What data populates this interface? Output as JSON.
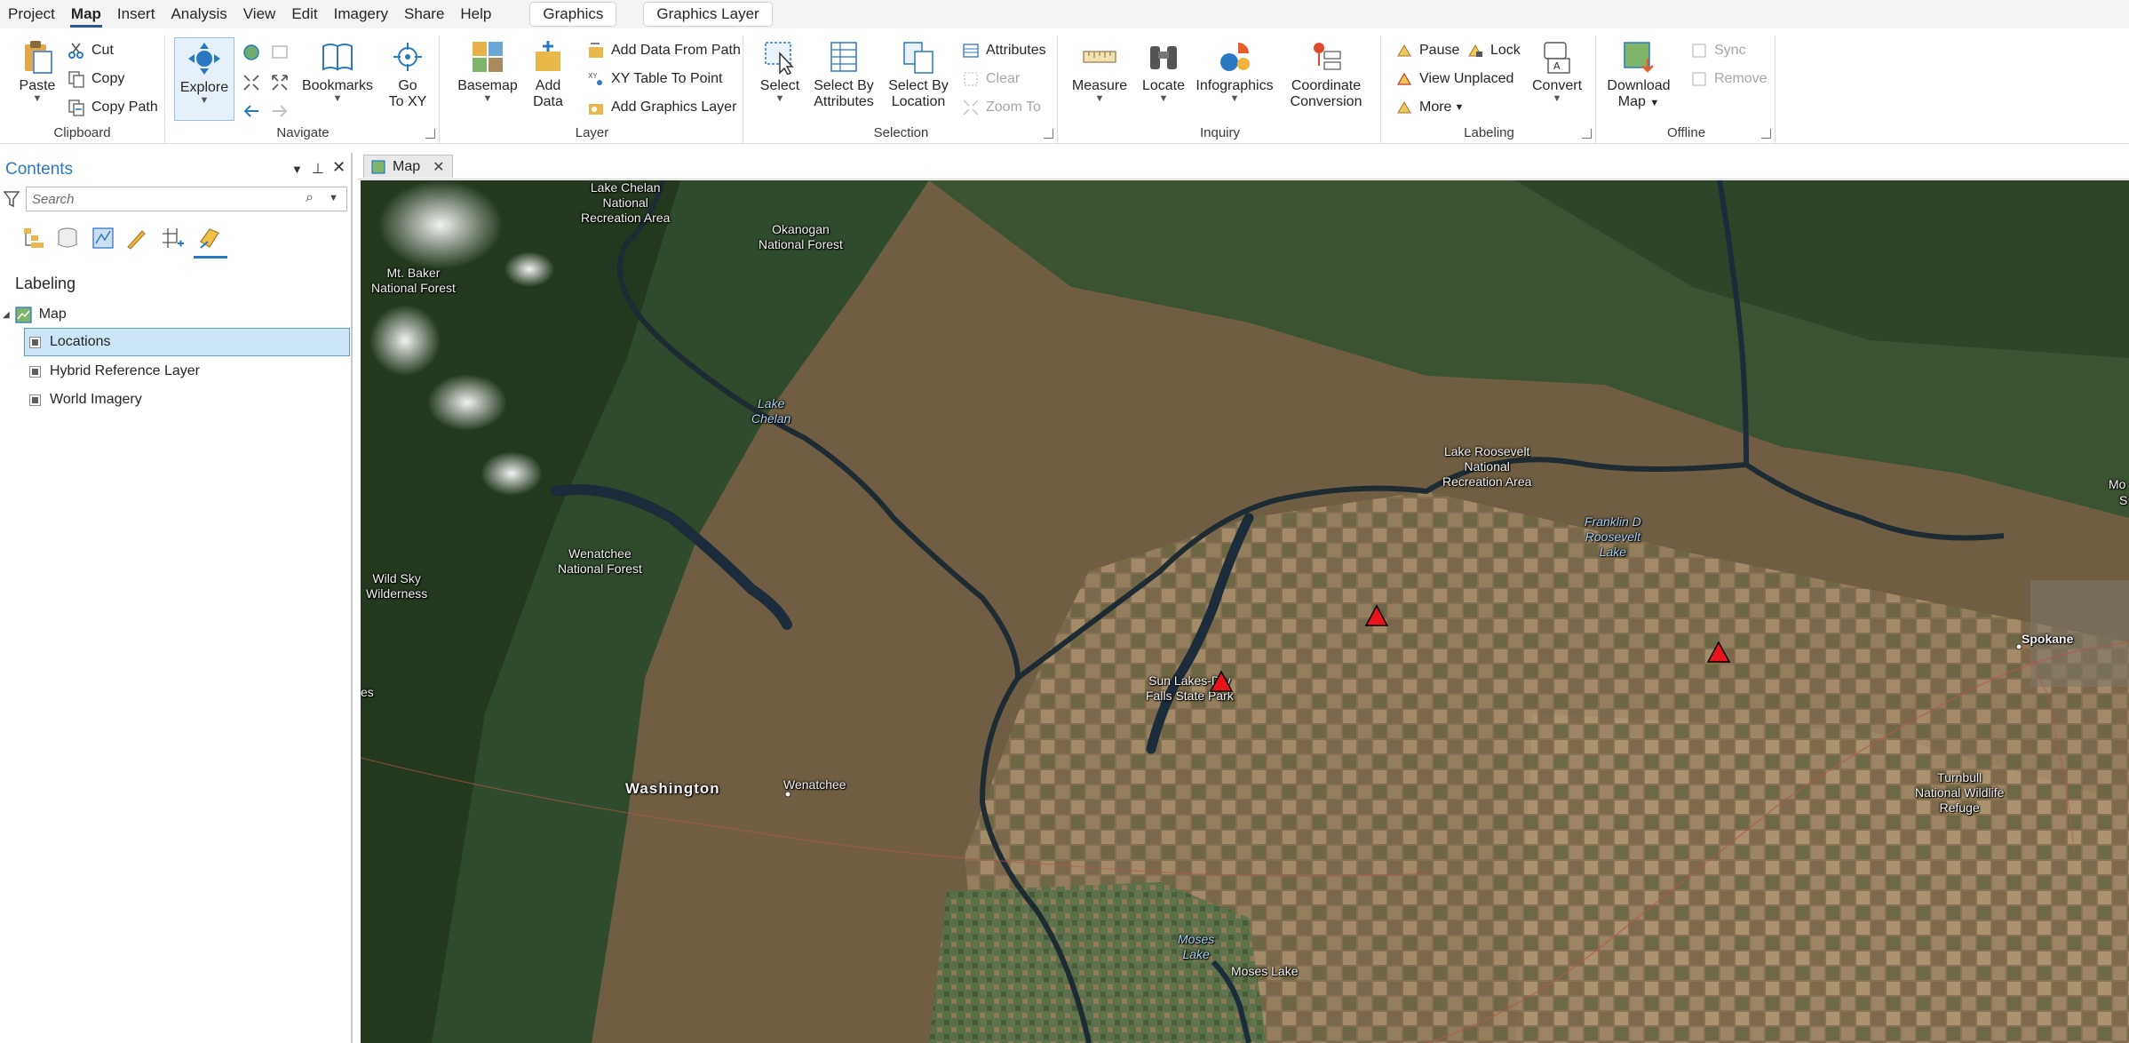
{
  "menubar": {
    "items": [
      "Project",
      "Map",
      "Insert",
      "Analysis",
      "View",
      "Edit",
      "Imagery",
      "Share",
      "Help"
    ],
    "contextual_tabs": [
      "Graphics",
      "Graphics Layer"
    ]
  },
  "ribbon": {
    "clipboard": {
      "title": "Clipboard",
      "paste": "Paste",
      "cut": "Cut",
      "copy": "Copy",
      "copy_path": "Copy Path"
    },
    "navigate": {
      "title": "Navigate",
      "explore": "Explore",
      "bookmarks": "Bookmarks",
      "go_to_xy_1": "Go",
      "go_to_xy_2": "To XY"
    },
    "layer": {
      "title": "Layer",
      "basemap": "Basemap",
      "add_data_1": "Add",
      "add_data_2": "Data",
      "add_data_from_path": "Add Data From Path",
      "xy_table_to_point": "XY Table To Point",
      "add_graphics_layer": "Add Graphics Layer"
    },
    "selection": {
      "title": "Selection",
      "select": "Select",
      "select_by_attributes_1": "Select By",
      "select_by_attributes_2": "Attributes",
      "select_by_location_1": "Select By",
      "select_by_location_2": "Location",
      "attributes": "Attributes",
      "clear": "Clear",
      "zoom_to": "Zoom To"
    },
    "inquiry": {
      "title": "Inquiry",
      "measure": "Measure",
      "locate": "Locate",
      "infographics": "Infographics",
      "coordinate_conversion_1": "Coordinate",
      "coordinate_conversion_2": "Conversion"
    },
    "labeling": {
      "title": "Labeling",
      "pause": "Pause",
      "lock": "Lock",
      "view_unplaced": "View Unplaced",
      "more": "More",
      "convert": "Convert"
    },
    "offline": {
      "title": "Offline",
      "download_map_1": "Download",
      "download_map_2": "Map",
      "sync": "Sync",
      "remove": "Remove"
    }
  },
  "contents": {
    "title": "Contents",
    "search_placeholder": "Search",
    "section": "Labeling",
    "map_node": "Map",
    "layers": [
      "Locations",
      "Hybrid Reference Layer",
      "World Imagery"
    ],
    "selected_layer": "Locations"
  },
  "map_view": {
    "tab_label": "Map",
    "labels": {
      "lake_chelan_nra": [
        "Lake Chelan",
        "National",
        "Recreation Area"
      ],
      "okanogan_nf": [
        "Okanogan",
        "National Forest"
      ],
      "mt_baker_nf": [
        "Mt. Baker",
        "National Forest"
      ],
      "lake_chelan_water": [
        "Lake",
        "Chelan"
      ],
      "wild_sky": [
        "Wild Sky",
        "Wilderness"
      ],
      "wenatchee_nf": [
        "Wenatchee",
        "National Forest"
      ],
      "lake_roosevelt_nra": [
        "Lake Roosevelt",
        "National",
        "Recreation Area"
      ],
      "franklin_roosevelt_lake": [
        "Franklin D",
        "Roosevelt",
        "Lake"
      ],
      "sun_lakes": [
        "Sun Lakes-Dry",
        "Falls State Park"
      ],
      "washington": "Washington",
      "wenatchee_city": "Wenatchee",
      "spokane": "Spokane",
      "turnbull": [
        "Turnbull",
        "National Wildlife",
        "Refuge"
      ],
      "moses_lake_water": [
        "Moses",
        "Lake"
      ],
      "moses_lake_city": "Moses Lake",
      "edge_right_1": "Mo",
      "edge_right_2": "S",
      "edge_left": "es"
    },
    "markers": [
      "location-marker-1",
      "location-marker-2",
      "location-marker-3"
    ],
    "marker_color": "#e8141c"
  },
  "colors": {
    "accent": "#2b78c2",
    "selection_bg": "#cde6f7"
  }
}
